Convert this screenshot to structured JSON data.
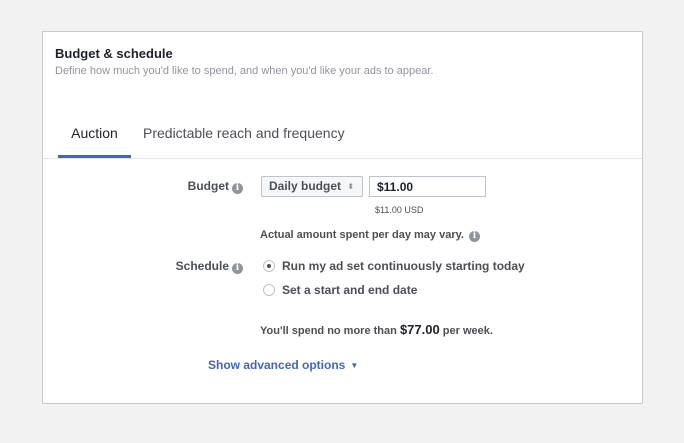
{
  "section": {
    "title": "Budget & schedule",
    "subtitle": "Define how much you'd like to spend, and when you'd like your ads to appear."
  },
  "tabs": [
    {
      "label": "Auction",
      "active": true
    },
    {
      "label": "Predictable reach and frequency",
      "active": false
    }
  ],
  "budget": {
    "label": "Budget",
    "type_selected": "Daily budget",
    "type_arrows": "⬍",
    "amount_value": "$11.00",
    "amount_usd": "$11.00 USD",
    "note": "Actual amount spent per day may vary."
  },
  "schedule": {
    "label": "Schedule",
    "options": [
      {
        "label": "Run my ad set continuously starting today",
        "checked": true
      },
      {
        "label": "Set a start and end date",
        "checked": false
      }
    ]
  },
  "spend_summary": {
    "prefix": "You'll spend no more than",
    "amount": "$77.00",
    "suffix": "per week."
  },
  "advanced": {
    "label": "Show advanced options",
    "caret": "▼"
  },
  "icons": {
    "info": "i"
  },
  "colors": {
    "accent": "#4267b2",
    "text": "#4b4f56",
    "muted": "#90949c",
    "background": "#f2f2f2"
  }
}
